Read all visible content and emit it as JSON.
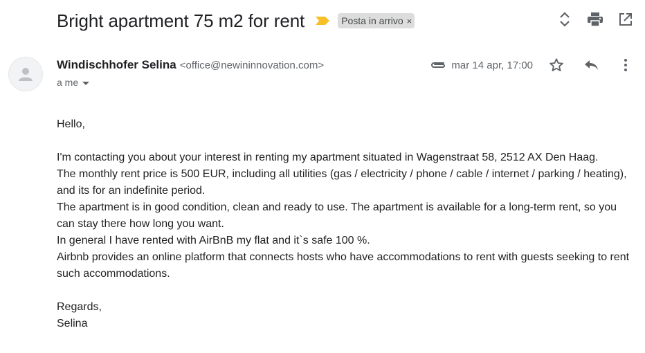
{
  "email": {
    "subject": "Bright apartment 75 m2 for rent",
    "label_chip": "Posta in arrivo",
    "label_chip_close": "×",
    "sender_name": "Windischhofer Selina",
    "sender_email": "<office@newininnovation.com>",
    "recipient_text": "a me",
    "date": "mar 14 apr, 17:00",
    "body": {
      "greeting": "Hello,",
      "paragraph_lines": [
        "I'm contacting you about your interest in renting my apartment situated in Wagenstraat 58, 2512 AX Den Haag.",
        "The monthly rent price is 500 EUR, including all utilities (gas / electricity / phone / cable / internet / parking / heating), and its for an indefinite period.",
        "The apartment is in good condition, clean and ready to use. The apartment is available for a long-term rent, so you can stay there how long you want.",
        "In general I have rented with AirBnB my flat and it`s safe 100 %.",
        "Airbnb provides an online platform that connects hosts who have accommodations to rent with guests seeking to rent such accommodations."
      ],
      "closing": "Regards,",
      "signature": "Selina"
    }
  },
  "icons": {
    "importance": "importance-marker-icon",
    "expand": "expand-collapse-icon",
    "print": "print-icon",
    "open_new_window": "open-in-new-window-icon",
    "avatar": "person-avatar-icon",
    "attachment": "attachment-icon",
    "star": "star-icon",
    "reply": "reply-icon",
    "more": "more-vertical-icon"
  },
  "colors": {
    "importance_marker": "#f6c026",
    "icon_gray": "#5f6368",
    "chip_bg": "#dddddd"
  }
}
